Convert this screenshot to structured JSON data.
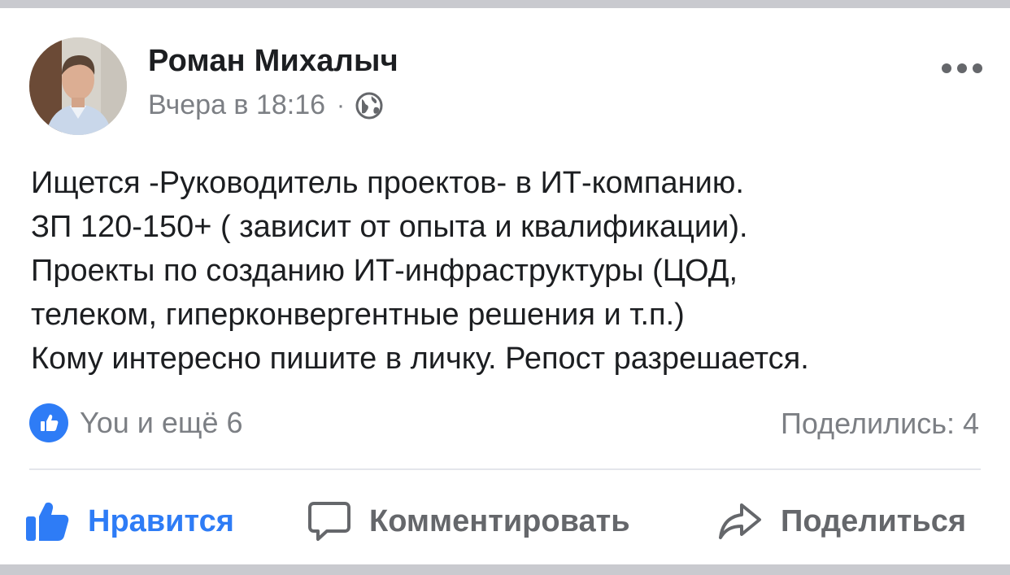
{
  "post": {
    "author": "Роман Михалыч",
    "time": "Вчера в 18:16",
    "separator": "·",
    "privacy_icon": "globe-icon",
    "more_icon": "more-options-icon",
    "text_lines": [
      "Ищется -Руководитель проектов- в ИТ-компанию.",
      "ЗП 120-150+ ( зависит от опыта и квалификации).",
      "Проекты по созданию ИТ-инфраструктуры (ЦОД,",
      "телеком, гиперконвергентные решения и т.п.)",
      "Кому интересно пишите в личку. Репост разрешается."
    ]
  },
  "stats": {
    "reactions_text": "You и ещё 6",
    "shares_text": "Поделились: 4"
  },
  "actions": {
    "like_label": "Нравится",
    "comment_label": "Комментировать",
    "share_label": "Поделиться"
  },
  "colors": {
    "accent": "#2e7cf6",
    "text": "#1c1e21",
    "secondary": "#7c7f84",
    "divider": "#e4e6eb"
  }
}
